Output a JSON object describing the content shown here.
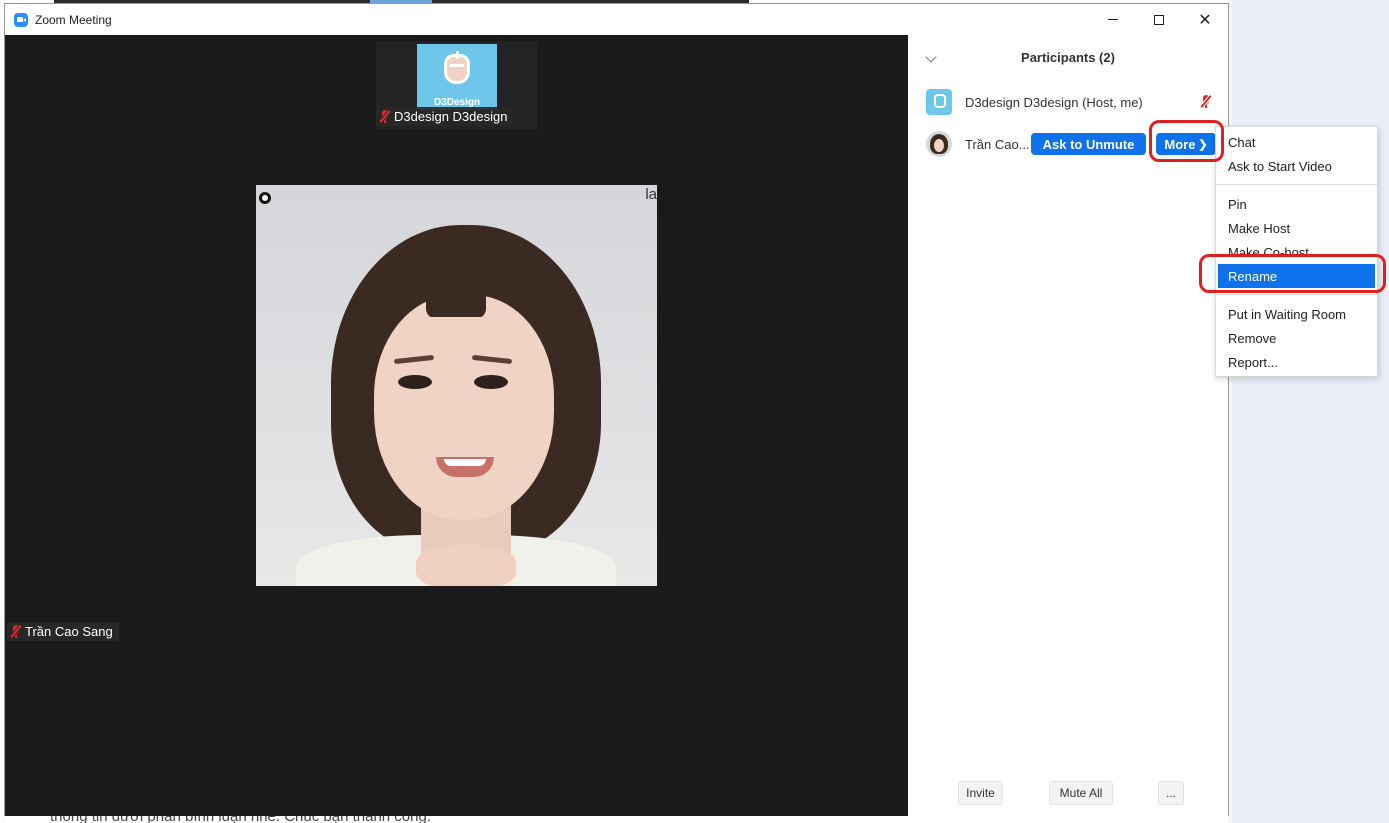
{
  "window": {
    "title": "Zoom Meeting"
  },
  "background": {
    "bottom_text": "thông tin dưới phần bình luận nhé. Chúc bạn thành công."
  },
  "video": {
    "thumbnail": {
      "brand": "D3Design",
      "name": "D3design D3design"
    },
    "main": {
      "name": "Trần Cao Sang",
      "corner_text": "la"
    }
  },
  "participants": {
    "title": "Participants (2)",
    "list": [
      {
        "name": "D3design D3design (Host, me)",
        "muted": true
      },
      {
        "name": "Trần Cao...",
        "ask_unmute_label": "Ask to Unmute",
        "more_label": "More",
        "more_arrow": "❯"
      }
    ],
    "footer": {
      "invite": "Invite",
      "mute_all": "Mute All",
      "more": "..."
    }
  },
  "context_menu": {
    "items": [
      {
        "label": "Chat"
      },
      {
        "label": "Ask to Start Video"
      },
      {
        "label": "Pin"
      },
      {
        "label": "Make Host"
      },
      {
        "label": "Make Co-host"
      },
      {
        "label": "Rename",
        "highlighted": true
      },
      {
        "label": "Put in Waiting Room"
      },
      {
        "label": "Remove"
      },
      {
        "label": "Report..."
      }
    ]
  },
  "colors": {
    "accent": "#0e72ed",
    "annotation": "#e02020",
    "mic_off": "#e02828"
  }
}
